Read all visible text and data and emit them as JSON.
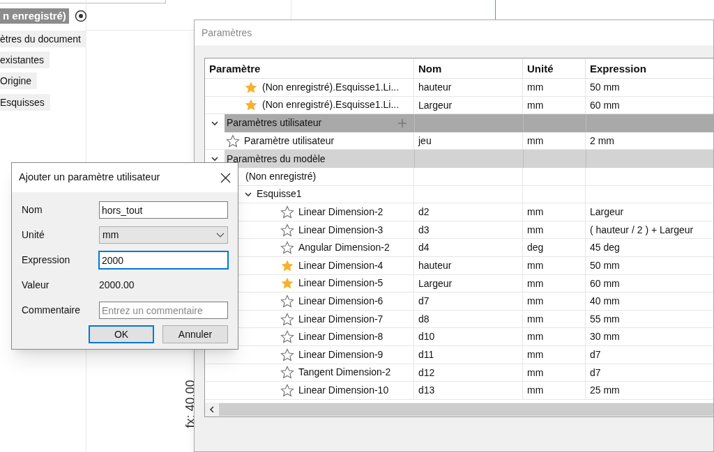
{
  "background": {
    "tree_items": [
      {
        "label": "n enregistré)",
        "kind": "root"
      },
      {
        "label": "ètres du document",
        "kind": "item"
      },
      {
        "label": "existantes",
        "kind": "item"
      },
      {
        "label": "Origine",
        "kind": "item"
      },
      {
        "label": "Esquisses",
        "kind": "item"
      }
    ],
    "canvas_label": "fx: 40.00"
  },
  "params_window": {
    "title": "Paramètres",
    "columns": [
      "Paramètre",
      "Nom",
      "Unité",
      "Expression"
    ],
    "rows": [
      {
        "kind": "param",
        "favorite": true,
        "parameter": "(Non enregistré).Esquisse1.Li...",
        "name": "hauteur",
        "unit": "mm",
        "expression": "50 mm"
      },
      {
        "kind": "param",
        "favorite": true,
        "parameter": "(Non enregistré).Esquisse1.Li...",
        "name": "Largeur",
        "unit": "mm",
        "expression": "60 mm"
      },
      {
        "kind": "group",
        "label": "Paramètres utilisateur",
        "selected": true,
        "expanded": true,
        "addable": true,
        "children": [
          {
            "kind": "param",
            "favorite": false,
            "parameter": "Paramètre utilisateur",
            "name": "jeu",
            "unit": "mm",
            "expression": "2 mm"
          }
        ]
      },
      {
        "kind": "group",
        "label": "Paramètres du modèle",
        "selected": false,
        "expanded": true,
        "addable": false,
        "children": [
          {
            "kind": "node",
            "label": "(Non enregistré)",
            "children": [
              {
                "kind": "node",
                "label": "Esquisse1",
                "expanded": true,
                "children": [
                  {
                    "kind": "param",
                    "favorite": false,
                    "parameter": "Linear Dimension-2",
                    "name": "d2",
                    "unit": "mm",
                    "expression": "Largeur"
                  },
                  {
                    "kind": "param",
                    "favorite": false,
                    "parameter": "Linear Dimension-3",
                    "name": "d3",
                    "unit": "mm",
                    "expression": "( hauteur / 2 ) + Largeur"
                  },
                  {
                    "kind": "param",
                    "favorite": false,
                    "parameter": "Angular Dimension-2",
                    "name": "d4",
                    "unit": "deg",
                    "expression": "45 deg"
                  },
                  {
                    "kind": "param",
                    "favorite": true,
                    "parameter": "Linear Dimension-4",
                    "name": "hauteur",
                    "unit": "mm",
                    "expression": "50 mm"
                  },
                  {
                    "kind": "param",
                    "favorite": true,
                    "parameter": "Linear Dimension-5",
                    "name": "Largeur",
                    "unit": "mm",
                    "expression": "60 mm"
                  },
                  {
                    "kind": "param",
                    "favorite": false,
                    "parameter": "Linear Dimension-6",
                    "name": "d7",
                    "unit": "mm",
                    "expression": "40 mm"
                  },
                  {
                    "kind": "param",
                    "favorite": false,
                    "parameter": "Linear Dimension-7",
                    "name": "d8",
                    "unit": "mm",
                    "expression": "55 mm"
                  },
                  {
                    "kind": "param",
                    "favorite": false,
                    "parameter": "Linear Dimension-8",
                    "name": "d10",
                    "unit": "mm",
                    "expression": "30 mm"
                  },
                  {
                    "kind": "param",
                    "favorite": false,
                    "parameter": "Linear Dimension-9",
                    "name": "d11",
                    "unit": "mm",
                    "expression": "d7"
                  },
                  {
                    "kind": "param",
                    "favorite": false,
                    "parameter": "Tangent Dimension-2",
                    "name": "d12",
                    "unit": "mm",
                    "expression": "d7"
                  },
                  {
                    "kind": "param",
                    "favorite": false,
                    "parameter": "Linear Dimension-10",
                    "name": "d13",
                    "unit": "mm",
                    "expression": "25 mm"
                  }
                ]
              }
            ]
          }
        ]
      }
    ]
  },
  "dialog": {
    "title": "Ajouter un paramètre utilisateur",
    "fields": [
      {
        "label": "Nom",
        "kind": "text",
        "value": "hors_tout",
        "focused": false
      },
      {
        "label": "Unité",
        "kind": "select",
        "value": "mm",
        "focused": false
      },
      {
        "label": "Expression",
        "kind": "text",
        "value": "2000",
        "focused": true
      },
      {
        "label": "Valeur",
        "kind": "readout",
        "value": "2000.00"
      },
      {
        "label": "Commentaire",
        "kind": "text",
        "placeholder": "Entrez un commentaire",
        "focused": false
      }
    ],
    "buttons": [
      {
        "label": "OK",
        "default": true
      },
      {
        "label": "Annuler",
        "default": false
      }
    ]
  }
}
